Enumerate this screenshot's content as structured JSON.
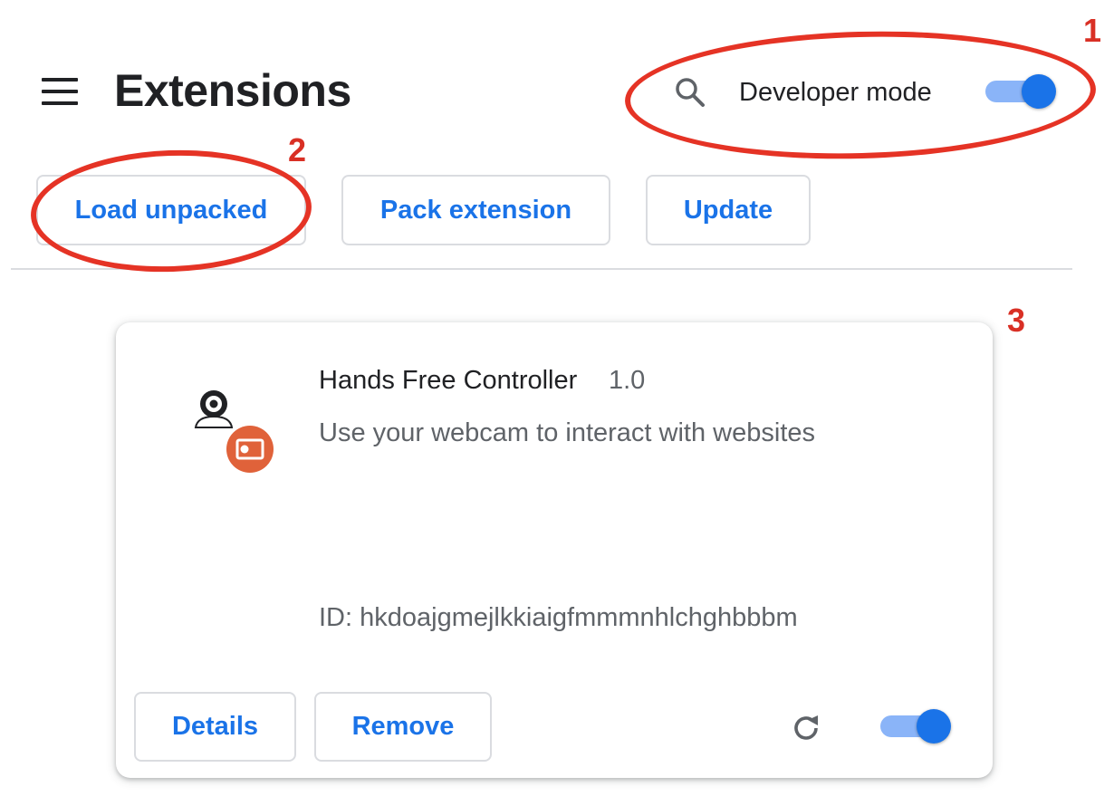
{
  "header": {
    "menu_icon": "hamburger-menu-icon",
    "title": "Extensions",
    "search_icon": "search-icon",
    "developer_mode_label": "Developer mode",
    "developer_mode_enabled": true
  },
  "toolbar": {
    "load_unpacked_label": "Load unpacked",
    "pack_extension_label": "Pack extension",
    "update_label": "Update"
  },
  "extension": {
    "name": "Hands Free Controller",
    "version": "1.0",
    "description": "Use your webcam to interact with websites",
    "id_text": "ID: hkdoajgmejlkkiaigfmmmnhlchghbbbm",
    "details_label": "Details",
    "remove_label": "Remove",
    "reload_icon": "reload-icon",
    "enabled": true,
    "icon": "webcam-extension-icon"
  },
  "annotations": [
    "1",
    "2",
    "3"
  ],
  "colors": {
    "accent": "#1a73e8",
    "toggle_track": "#8ab4f8",
    "annotation_red": "#e53325",
    "icon_orange": "#e0623a"
  }
}
